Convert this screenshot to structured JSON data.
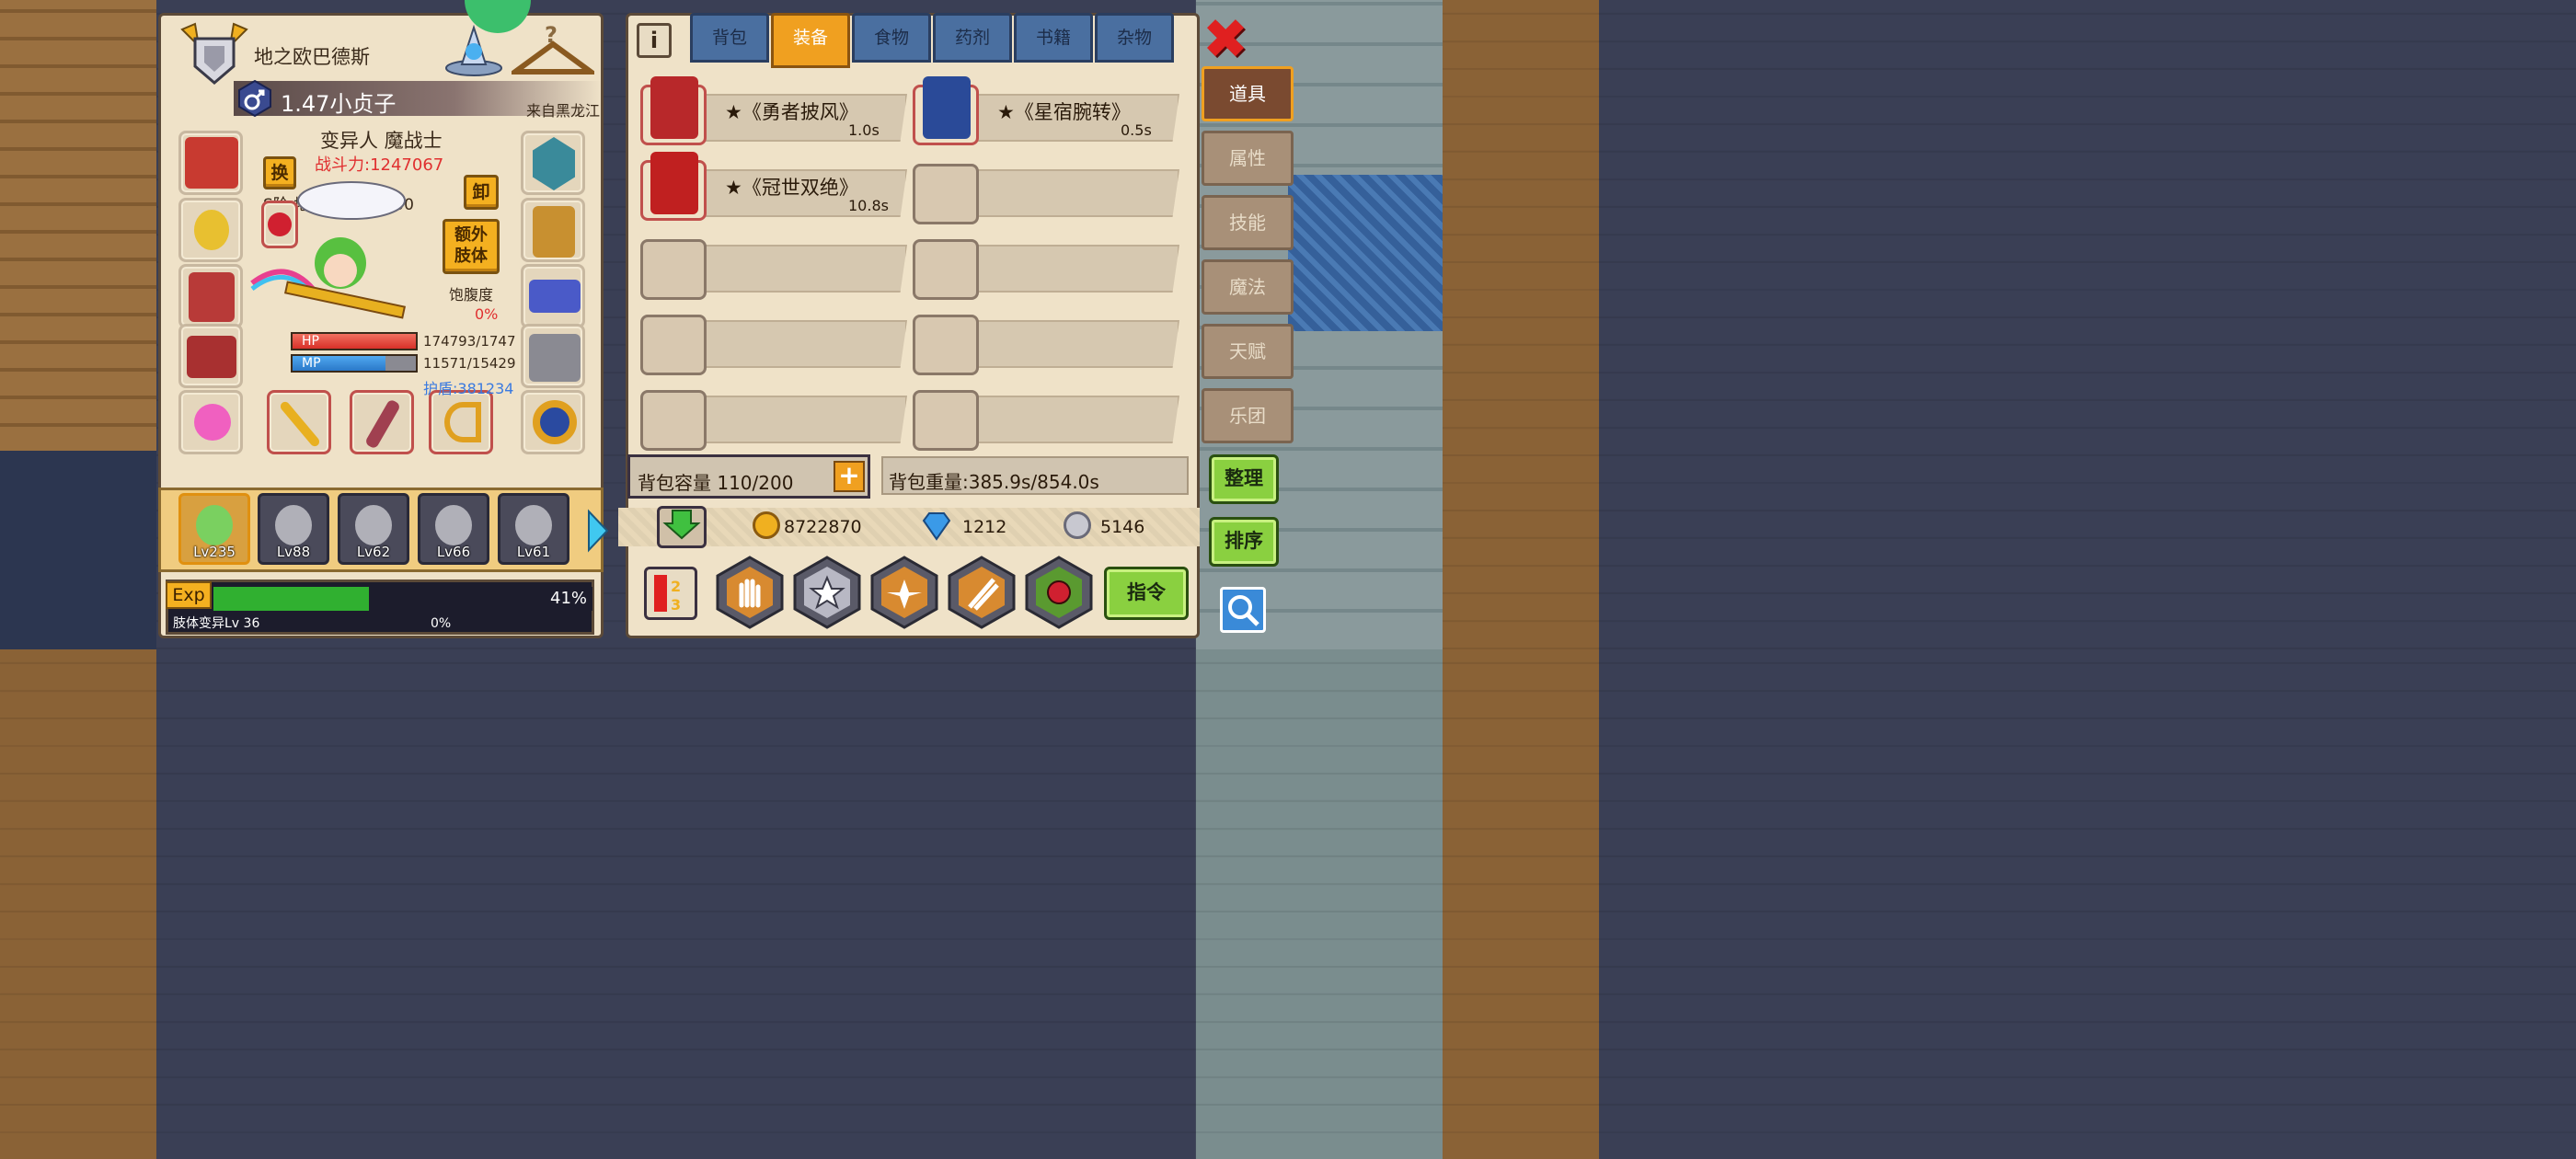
{
  "character": {
    "title": "地之欧巴德斯",
    "player_name": "1.47小贞子",
    "origin": "来自黑龙江",
    "race_class": "变异人 魔战士",
    "power": "战斗力:1247067",
    "rank": "S阶 地狱使徒 Lv 100",
    "swap_label": "换",
    "unequip_label": "卸",
    "extra_limb_label": "额外\n肢体",
    "satiety_label": "饱腹度",
    "satiety_value": "0%",
    "hp_label": "HP",
    "hp_value": "174793/1747",
    "hp_fraction": 1.0,
    "mp_label": "MP",
    "mp_value": "11571/15429",
    "mp_fraction": 0.75,
    "shield": "护盾:381234"
  },
  "party": [
    {
      "level": "Lv235",
      "active": true
    },
    {
      "level": "Lv88",
      "active": false
    },
    {
      "level": "Lv62",
      "active": false
    },
    {
      "level": "Lv66",
      "active": false
    },
    {
      "level": "Lv61",
      "active": false
    }
  ],
  "exp": {
    "label": "Exp",
    "percent_text": "41%",
    "fraction": 0.41,
    "limb_label": "肢体变异Lv 36",
    "limb_percent": "0%"
  },
  "tabs": [
    "背包",
    "装备",
    "食物",
    "药剂",
    "书籍",
    "杂物"
  ],
  "active_tab": 1,
  "inventory": [
    {
      "name": "★《勇者披风》",
      "time": "1.0s",
      "icon": "cape-icon"
    },
    {
      "name": "★《星宿腕转》",
      "time": "0.5s",
      "icon": "bracer-icon"
    },
    {
      "name": "★《冠世双绝》",
      "time": "10.8s",
      "icon": "claw-icon"
    },
    {
      "name": "",
      "time": ""
    },
    {
      "name": "",
      "time": ""
    },
    {
      "name": "",
      "time": ""
    },
    {
      "name": "",
      "time": ""
    },
    {
      "name": "",
      "time": ""
    },
    {
      "name": "",
      "time": ""
    },
    {
      "name": "",
      "time": ""
    }
  ],
  "side_tabs": [
    "道具",
    "属性",
    "技能",
    "魔法",
    "天赋",
    "乐团"
  ],
  "active_side_tab": 0,
  "bag": {
    "capacity": "背包容量 110/200",
    "weight": "背包重量:385.9s/854.0s"
  },
  "buttons": {
    "sort_organize": "整理",
    "sort_order": "排序",
    "command": "指令",
    "close": "✖",
    "info": "i"
  },
  "currency": {
    "gold": "8722870",
    "gems": "1212",
    "silver": "5146"
  },
  "colors": {
    "gold_tab": "#f0a020",
    "blue_tab": "#4a6fa0",
    "hp": "#e85040",
    "mp": "#3a8ad8",
    "exp": "#30b030",
    "power_red": "#e03030",
    "shield_blue": "#3a7ae0"
  }
}
